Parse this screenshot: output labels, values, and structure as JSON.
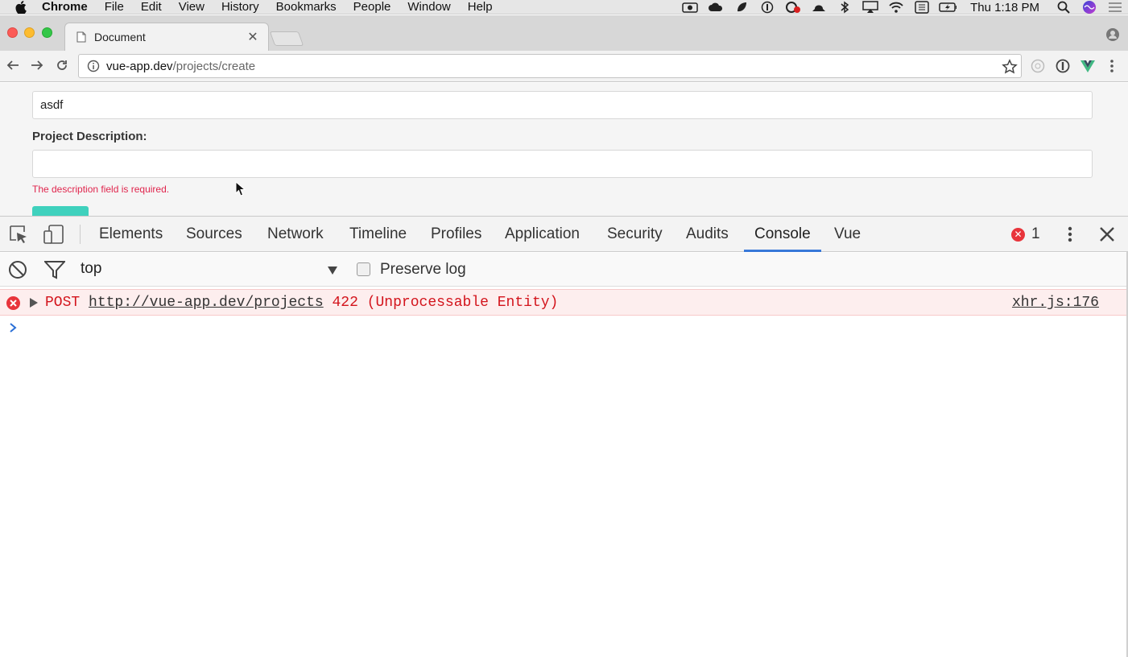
{
  "menubar": {
    "app": "Chrome",
    "items": [
      "File",
      "Edit",
      "View",
      "History",
      "Bookmarks",
      "People",
      "Window",
      "Help"
    ],
    "clock": "Thu 1:18 PM"
  },
  "tab": {
    "title": "Document"
  },
  "omnibox": {
    "host": "vue-app.dev",
    "path": "/projects/create"
  },
  "form": {
    "name_value": "asdf",
    "description_label": "Project Description:",
    "description_value": "",
    "error": "The description field is required."
  },
  "devtools": {
    "tabs": [
      "Elements",
      "Sources",
      "Network",
      "Timeline",
      "Profiles",
      "Application",
      "Security",
      "Audits",
      "Console",
      "Vue"
    ],
    "active_tab": "Console",
    "error_count": "1",
    "context": "top",
    "preserve_log_label": "Preserve log",
    "log": {
      "method": "POST",
      "url": "http://vue-app.dev/projects",
      "status": "422 (Unprocessable Entity)",
      "source": "xhr.js:176"
    }
  },
  "colors": {
    "error": "#d3141c",
    "active_tab_underline": "#3879d9",
    "submit_button": "#3fd1bd",
    "form_error": "#e0254d"
  }
}
